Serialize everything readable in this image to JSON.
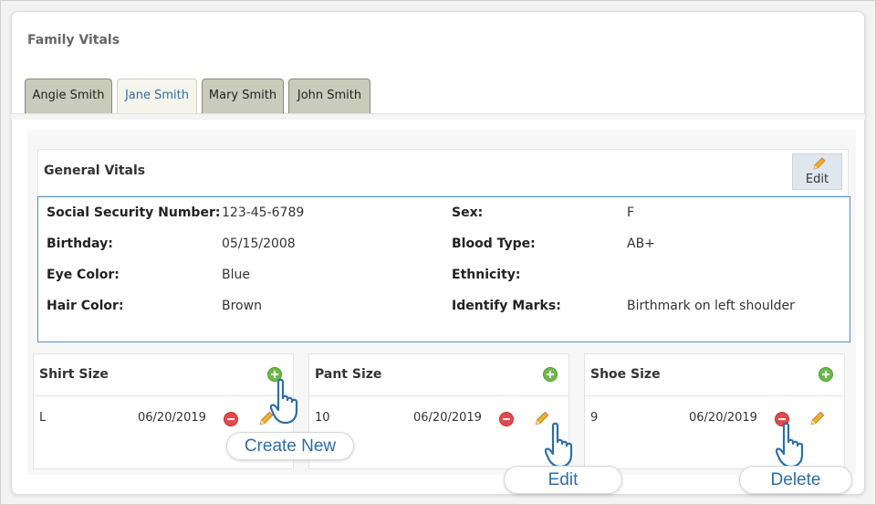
{
  "panel": {
    "title": "Family Vitals"
  },
  "tabs": [
    {
      "label": "Angie Smith",
      "active": false
    },
    {
      "label": "Jane Smith",
      "active": true
    },
    {
      "label": "Mary Smith",
      "active": false
    },
    {
      "label": "John Smith",
      "active": false
    }
  ],
  "general_vitals": {
    "title": "General Vitals",
    "edit_label": "Edit",
    "fields": [
      {
        "label": "Social Security Number:",
        "value": "123-45-6789"
      },
      {
        "label": "Birthday:",
        "value": "05/15/2008"
      },
      {
        "label": "Eye Color:",
        "value": "Blue"
      },
      {
        "label": "Hair Color:",
        "value": "Brown"
      },
      {
        "label": "Sex:",
        "value": "F"
      },
      {
        "label": "Blood Type:",
        "value": "AB+"
      },
      {
        "label": "Ethnicity:",
        "value": ""
      },
      {
        "label": "Identify Marks:",
        "value": "Birthmark on left shoulder"
      }
    ]
  },
  "sizes": [
    {
      "title": "Shirt Size",
      "size": "L",
      "date": "06/20/2019"
    },
    {
      "title": "Pant Size",
      "size": "10",
      "date": "06/20/2019"
    },
    {
      "title": "Shoe Size",
      "size": "9",
      "date": "06/20/2019"
    }
  ],
  "callouts": {
    "create_new": "Create New",
    "edit": "Edit",
    "delete": "Delete"
  },
  "colors": {
    "accent_blue": "#2f6f9f",
    "add_green": "#6cba4a",
    "delete_red": "#e5494b",
    "pencil_yellow": "#f0b429"
  },
  "icons": [
    "plus-circle-icon",
    "minus-circle-icon",
    "pencil-icon",
    "pointing-hand-icon"
  ]
}
